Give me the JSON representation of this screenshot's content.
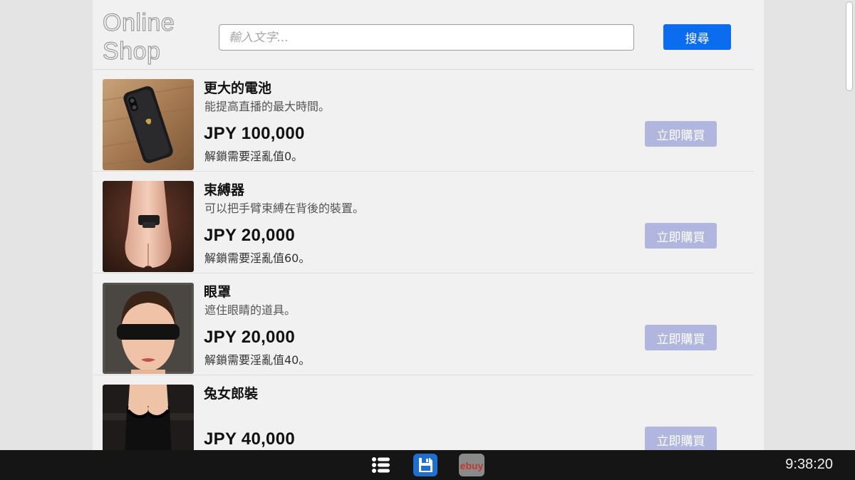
{
  "shop": {
    "logo": [
      "Online",
      "Shop"
    ],
    "search": {
      "placeholder": "輸入文字...",
      "value": ""
    },
    "search_button": "搜尋"
  },
  "products": [
    {
      "name": "更大的電池",
      "description": "能提高直播的最大時間。",
      "price": "JPY 100,000",
      "unlock": "解鎖需要淫亂值0。",
      "buy_label": "立即購買",
      "image_icon": "smartphone-image"
    },
    {
      "name": "束縛器",
      "description": "可以把手臂束縛在背後的裝置。",
      "price": "JPY 20,000",
      "unlock": "解鎖需要淫亂值60。",
      "buy_label": "立即購買",
      "image_icon": "arm-restraint-image"
    },
    {
      "name": "眼罩",
      "description": "遮住眼睛的道具。",
      "price": "JPY 20,000",
      "unlock": "解鎖需要淫亂值40。",
      "buy_label": "立即購買",
      "image_icon": "blindfold-image"
    },
    {
      "name": "兔女郎裝",
      "description": "",
      "price": "JPY 40,000",
      "unlock": "",
      "buy_label": "立即購買",
      "image_icon": "bunny-suit-image"
    }
  ],
  "taskbar": {
    "icons": [
      "list-icon",
      "save-icon",
      "ebuy-app-icon"
    ],
    "ebuy_label": "ebuy",
    "clock": "9:38:20"
  },
  "colors": {
    "accent": "#0b6cf0",
    "buy_button": "#b1b6de",
    "panel_bg": "#f1f1f1",
    "taskbar_bg": "#151515"
  }
}
